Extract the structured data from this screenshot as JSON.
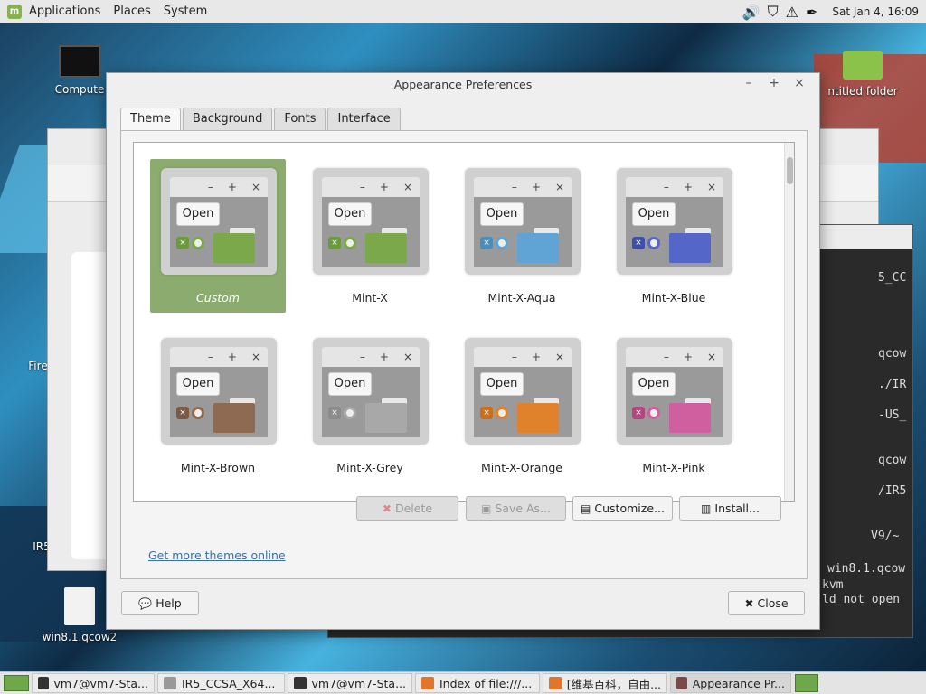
{
  "top_panel": {
    "menus": [
      "Applications",
      "Places",
      "System"
    ],
    "clock": "Sat Jan  4, 16:09"
  },
  "desktop": {
    "icons": [
      "Compute",
      "ntitled folder",
      "Fire",
      "IR5",
      "win8.1.qcow2"
    ]
  },
  "terminal_bg": {
    "lines": [
      "5_CC",
      "qcow",
      "./IR",
      "-US_",
      "qcow",
      "/IR5",
      "V9/~",
      "win8.1.qcow",
      "kvm",
      "ld not open"
    ]
  },
  "dialog": {
    "title": "Appearance Preferences",
    "tabs": [
      "Theme",
      "Background",
      "Fonts",
      "Interface"
    ],
    "themes": [
      {
        "name": "Custom",
        "accent": "#7aa84b",
        "x_color": "#6a9a3c"
      },
      {
        "name": "Mint-X",
        "accent": "#7aa84b",
        "x_color": "#6a9a3c"
      },
      {
        "name": "Mint-X-Aqua",
        "accent": "#5fa4d4",
        "x_color": "#4a8cba"
      },
      {
        "name": "Mint-X-Blue",
        "accent": "#5467c8",
        "x_color": "#3f4ea8"
      },
      {
        "name": "Mint-X-Brown",
        "accent": "#8e6a52",
        "x_color": "#7a5a44"
      },
      {
        "name": "Mint-X-Grey",
        "accent": "#a8a8a8",
        "x_color": "#8c8c8c"
      },
      {
        "name": "Mint-X-Orange",
        "accent": "#e0822b",
        "x_color": "#c96f1e"
      },
      {
        "name": "Mint-X-Pink",
        "accent": "#d05fa0",
        "x_color": "#b2467f"
      }
    ],
    "preview_open_label": "Open",
    "buttons": {
      "delete": "Delete",
      "save_as": "Save As...",
      "customize": "Customize...",
      "install": "Install...",
      "help": "Help",
      "close": "Close"
    },
    "link_text": "Get more themes online"
  },
  "taskbar": {
    "items": [
      "vm7@vm7-Sta...",
      "IR5_CCSA_X64...",
      "vm7@vm7-Sta...",
      "Index of file:///...",
      "[维基百科，自由...",
      "Appearance Pr..."
    ]
  }
}
